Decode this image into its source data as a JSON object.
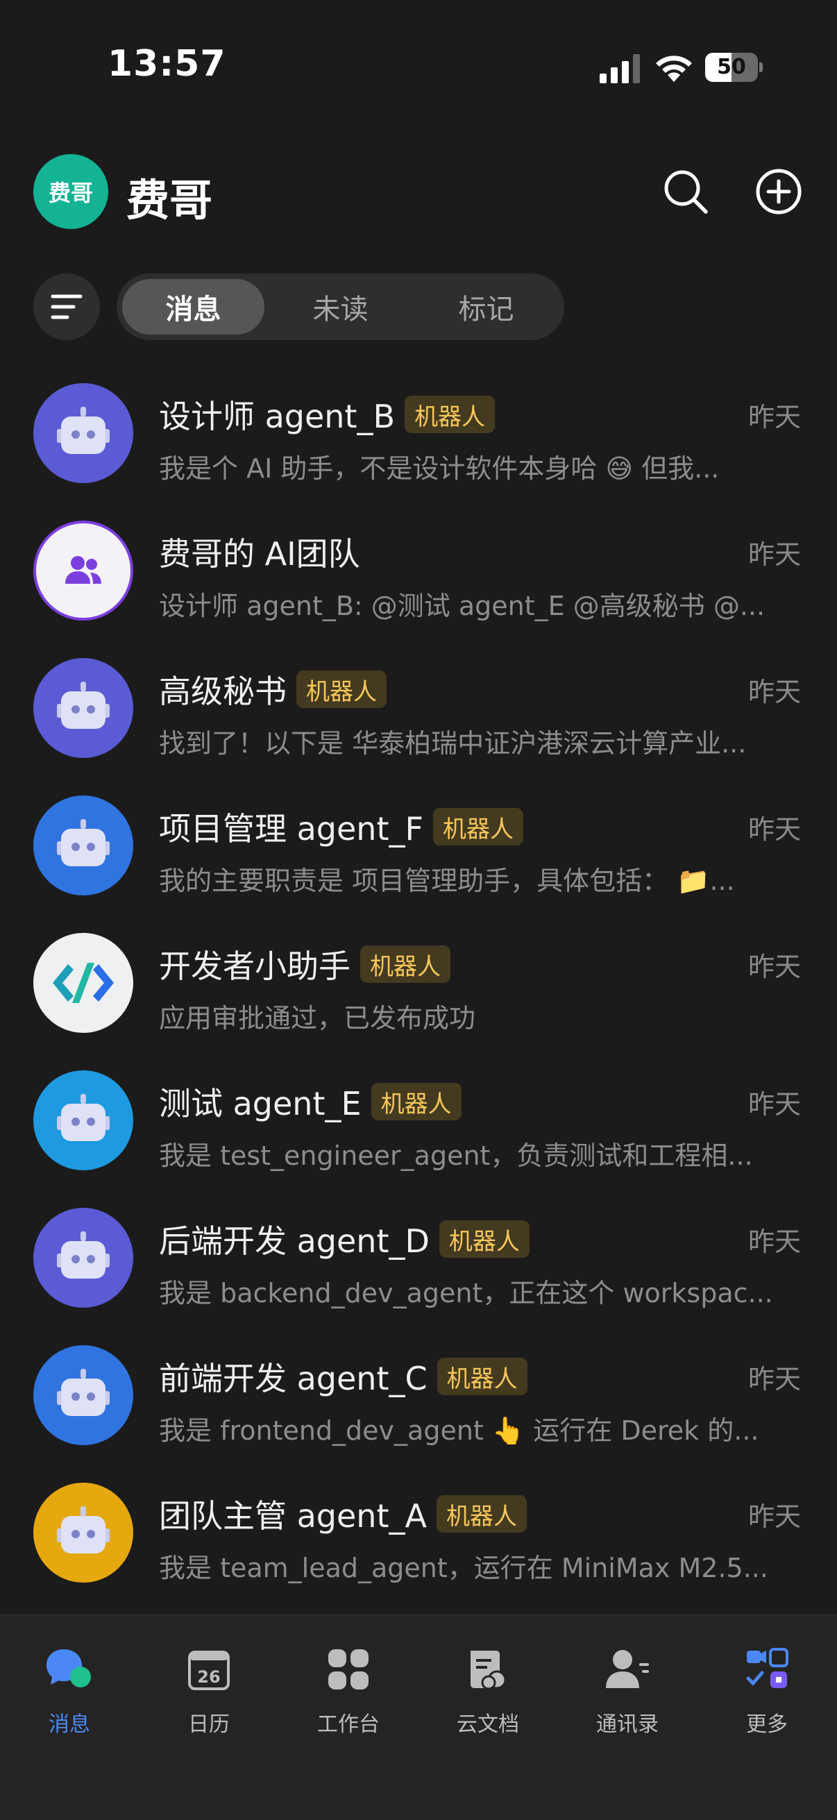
{
  "status_bar": {
    "time": "13:57",
    "battery_level": "50",
    "battery_fraction": 0.5,
    "icons": [
      "signal-icon",
      "wifi-icon",
      "battery-icon"
    ]
  },
  "header": {
    "avatar_text": "费哥",
    "title": "费哥",
    "icons": [
      "search-icon",
      "plus-circle-icon"
    ],
    "accent_color": "#13b394"
  },
  "filter": {
    "menu_icon": "filter-menu-icon",
    "tabs": [
      {
        "label": "消息",
        "active": true
      },
      {
        "label": "未读",
        "active": false
      },
      {
        "label": "标记",
        "active": false
      }
    ]
  },
  "bot_badge_label": "机器人",
  "chats": [
    {
      "name": "设计师 agent_B",
      "bot": true,
      "time": "昨天",
      "preview": "我是个 AI 助手，不是设计软件本身哈 😅 但我...",
      "avatar": "robot-icon",
      "avatar_color": "#5b5bd6"
    },
    {
      "name": "费哥的 AI团队",
      "bot": false,
      "time": "昨天",
      "preview": "设计师 agent_B: @测试 agent_E @高级秘书 @...",
      "avatar": "group-icon",
      "avatar_color": "#f4f2f7"
    },
    {
      "name": "高级秘书",
      "bot": true,
      "time": "昨天",
      "preview": "找到了！以下是 华泰柏瑞中证沪港深云计算产业...",
      "avatar": "robot-icon",
      "avatar_color": "#5b5bd6"
    },
    {
      "name": "项目管理 agent_F",
      "bot": true,
      "time": "昨天",
      "preview": "我的主要职责是 项目管理助手，具体包括： 📁...",
      "avatar": "robot-icon",
      "avatar_color": "#2f74e0"
    },
    {
      "name": "开发者小助手",
      "bot": true,
      "time": "昨天",
      "preview": "应用审批通过，已发布成功",
      "avatar": "code-icon",
      "avatar_color": "#eef0f2"
    },
    {
      "name": "测试 agent_E",
      "bot": true,
      "time": "昨天",
      "preview": "我是 test_engineer_agent，负责测试和工程相...",
      "avatar": "robot-icon",
      "avatar_color": "#1e9ae0"
    },
    {
      "name": "后端开发 agent_D",
      "bot": true,
      "time": "昨天",
      "preview": "我是 backend_dev_agent，正在这个 workspac...",
      "avatar": "robot-icon",
      "avatar_color": "#5b5bd6"
    },
    {
      "name": "前端开发 agent_C",
      "bot": true,
      "time": "昨天",
      "preview": "我是 frontend_dev_agent 👆 运行在 Derek 的...",
      "avatar": "robot-icon",
      "avatar_color": "#2f74e0"
    },
    {
      "name": "团队主管 agent_A",
      "bot": true,
      "time": "昨天",
      "preview": "我是 team_lead_agent，运行在 MiniMax M2.5...",
      "avatar": "robot-icon",
      "avatar_color": "#e6a80f"
    }
  ],
  "bottom_nav": [
    {
      "label": "消息",
      "icon": "chat-bubble-icon",
      "active": true
    },
    {
      "label": "日历",
      "icon": "calendar-icon",
      "active": false,
      "calendar_day": "26"
    },
    {
      "label": "工作台",
      "icon": "workspace-grid-icon",
      "active": false
    },
    {
      "label": "云文档",
      "icon": "cloud-doc-icon",
      "active": false
    },
    {
      "label": "通讯录",
      "icon": "contacts-icon",
      "active": false
    },
    {
      "label": "更多",
      "icon": "more-apps-icon",
      "active": false
    }
  ],
  "colors": {
    "background": "#1b1b1b",
    "nav_active": "#4b88f5",
    "badge_text": "#f7c75a",
    "badge_bg": "#433a20"
  }
}
